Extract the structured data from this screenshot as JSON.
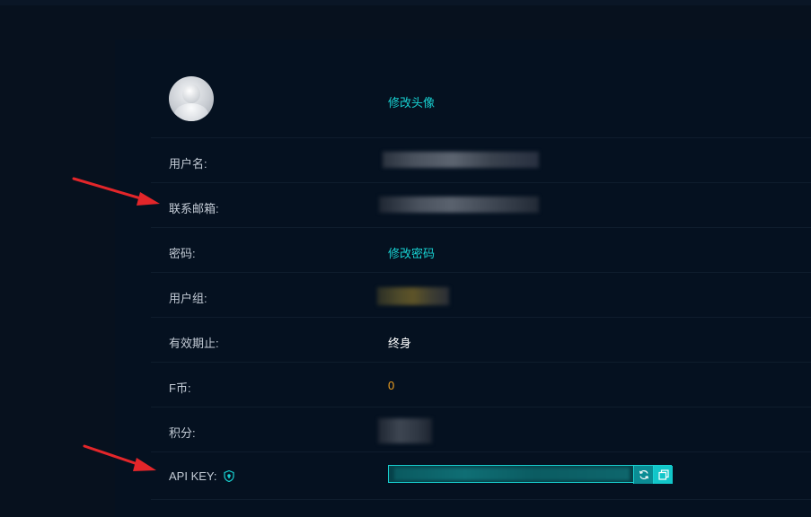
{
  "profile": {
    "avatar_icon": "user-avatar-icon",
    "change_avatar_label": "修改头像"
  },
  "fields": {
    "username_label": "用户名:",
    "email_label": "联系邮箱:",
    "password_label": "密码:",
    "change_password_label": "修改密码",
    "usergroup_label": "用户组:",
    "expiry_label": "有效期止:",
    "expiry_value": "终身",
    "fcoin_label": "F币:",
    "fcoin_value": "0",
    "points_label": "积分:",
    "apikey_label": "API KEY:"
  },
  "icons": {
    "shield": "shield-icon",
    "refresh": "refresh-icon",
    "copy": "copy-icon"
  },
  "colors": {
    "accent": "#18d3d3",
    "background": "#051120",
    "fcoin": "#f0a020"
  }
}
